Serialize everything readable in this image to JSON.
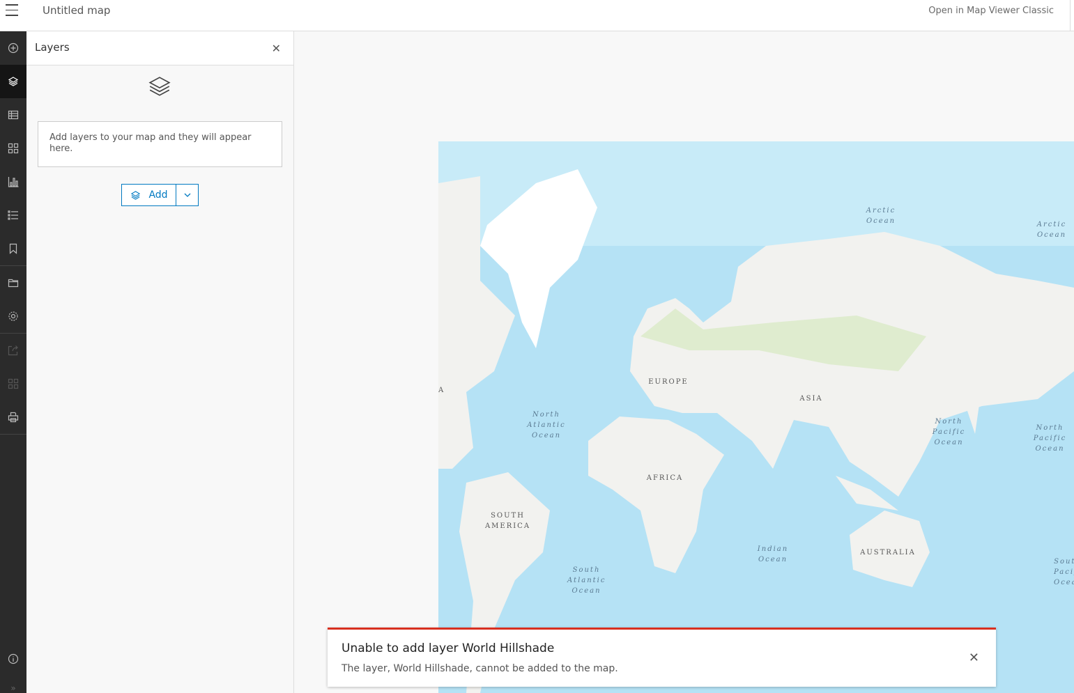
{
  "header": {
    "title": "Untitled map",
    "classic_link": "Open in Map Viewer Classic"
  },
  "rail": {
    "items": [
      "add-icon",
      "layers-icon",
      "table-icon",
      "widgets-icon",
      "chart-icon",
      "legend-icon",
      "bookmark-icon",
      "folder-icon",
      "gear-icon",
      "share-icon",
      "apps-icon",
      "print-icon"
    ],
    "active": "layers-icon"
  },
  "panel": {
    "title": "Layers",
    "empty_text": "Add layers to your map and they will appear here.",
    "add_label": "Add"
  },
  "map": {
    "labels": {
      "arctic1": "Arctic Ocean",
      "arctic2": "Arctic Ocean",
      "europe": "EUROPE",
      "asia": "ASIA",
      "natl": "North Atlantic Ocean",
      "npac1": "North Pacific Ocean",
      "npac2": "North Pacific Ocean",
      "africa": "AFRICA",
      "sam": "SOUTH AMERICA",
      "indian": "Indian Ocean",
      "australia": "AUSTRALIA",
      "satl": "South Atlantic Ocean",
      "spac": "South Pacific Ocean",
      "a": "A"
    },
    "colors": {
      "water": "#b5e2f5",
      "land": "#f2f2ef",
      "veg": "#dfeccf"
    }
  },
  "toast": {
    "title": "Unable to add layer World Hillshade",
    "message": "The layer, World Hillshade, cannot be added to the map.",
    "accent": "#d83020"
  }
}
